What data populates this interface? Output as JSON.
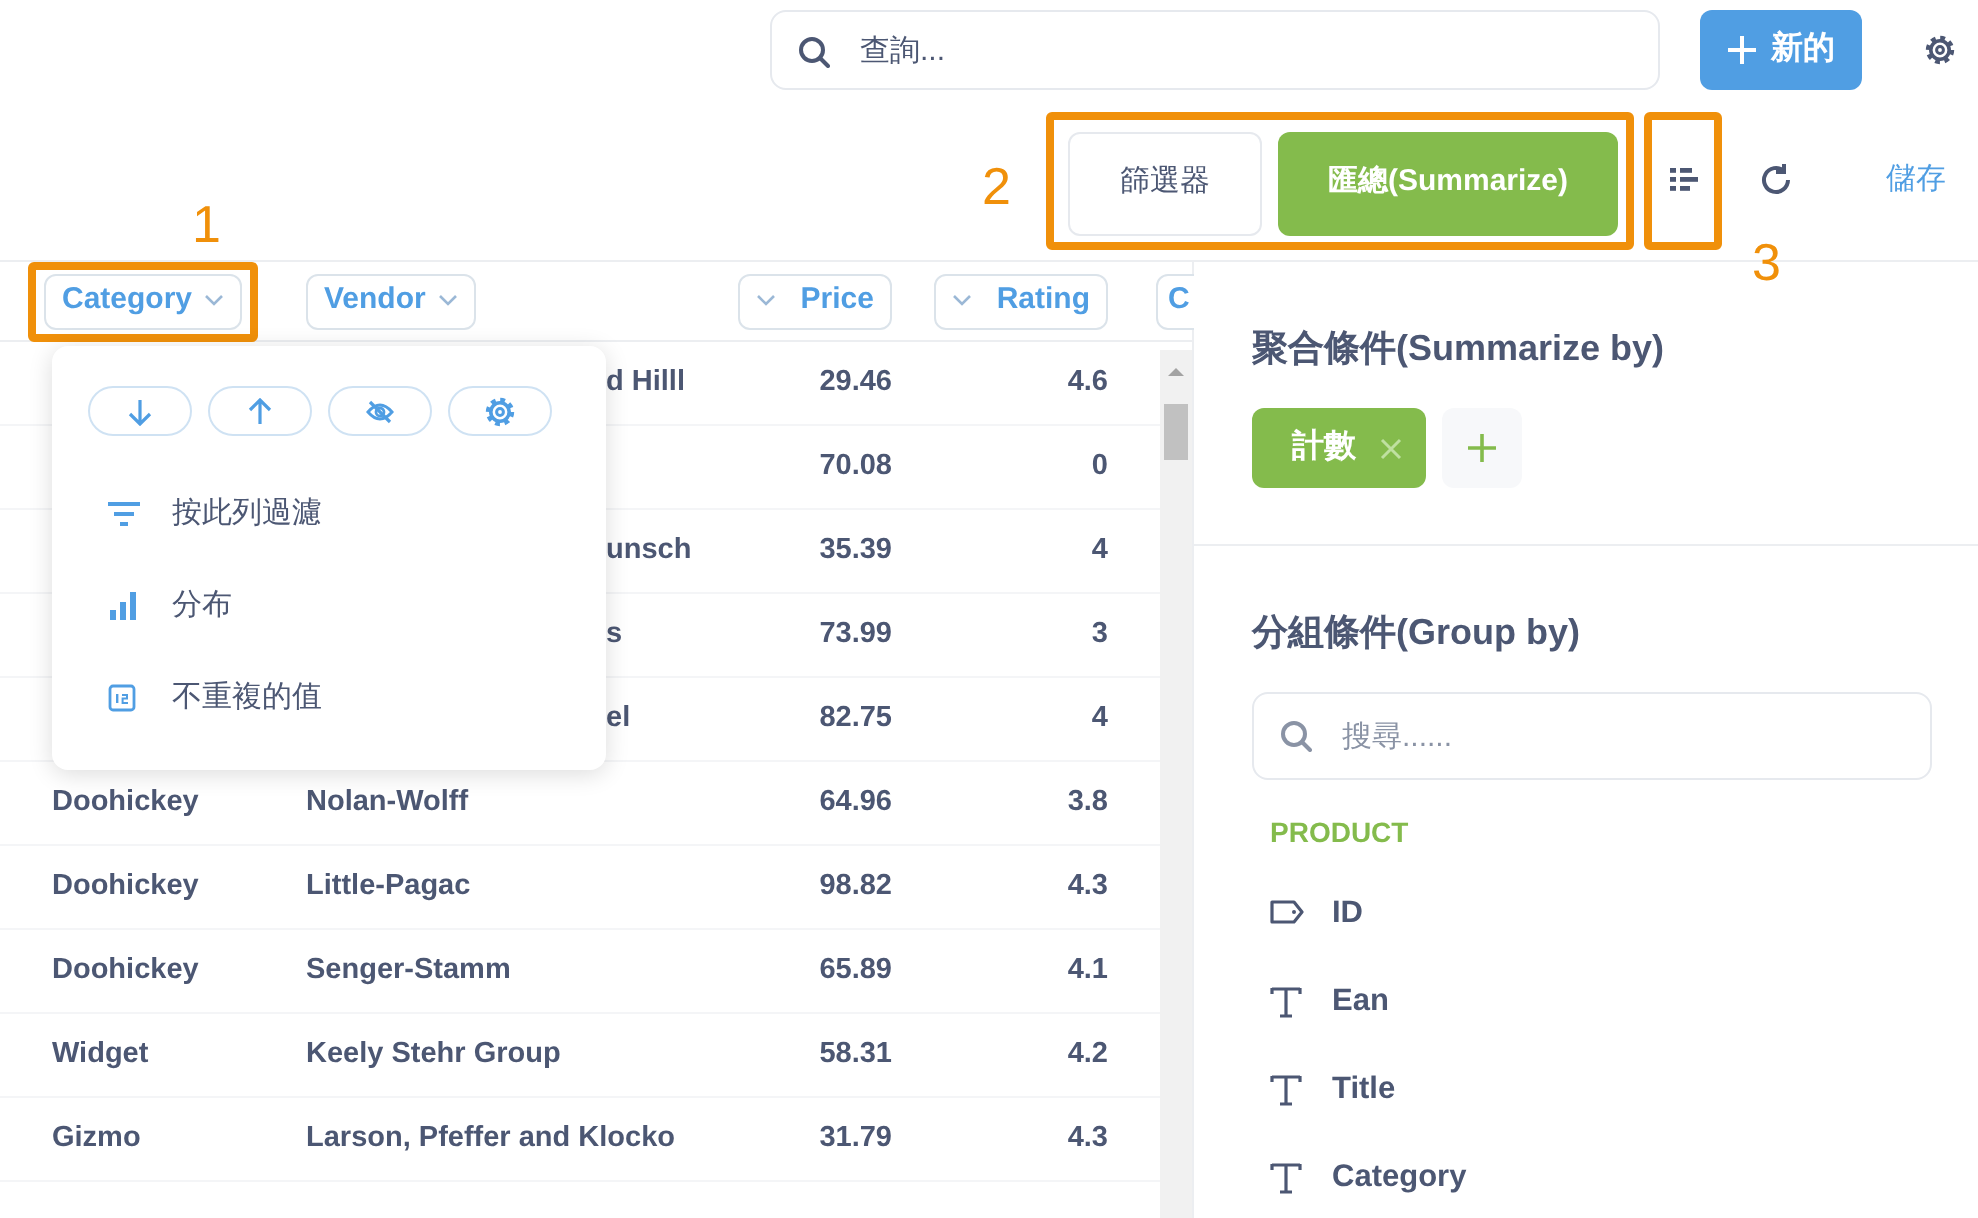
{
  "header": {
    "search": {
      "placeholder": "查詢..."
    },
    "new_button": "新的"
  },
  "toolbar": {
    "annotation": "2",
    "filter_button": "篩選器",
    "summarize_button": {
      "label": "匯總(Summarize)",
      "selected": true
    },
    "view_annotation": "3",
    "save_link": "儲存"
  },
  "table": {
    "columns": [
      {
        "label": "Category",
        "kind": "text",
        "annotation": "1"
      },
      {
        "label": "Vendor",
        "kind": "text"
      },
      {
        "label": "Price",
        "kind": "number"
      },
      {
        "label": "Rating",
        "kind": "number"
      },
      {
        "label": "C",
        "kind": "cut"
      }
    ],
    "rows": [
      {
        "vendor": "d Hilll",
        "vendor_clipped": true,
        "price": "29.46",
        "rating": "4.6"
      },
      {
        "price": "70.08",
        "rating": "0"
      },
      {
        "vendor": "unsch",
        "vendor_clipped": true,
        "price": "35.39",
        "rating": "4"
      },
      {
        "vendor": "s",
        "vendor_clipped": true,
        "price": "73.99",
        "rating": "3"
      },
      {
        "vendor": "el",
        "vendor_clipped": true,
        "price": "82.75",
        "rating": "4"
      },
      {
        "category": "Doohickey",
        "vendor": "Nolan-Wolff",
        "price": "64.96",
        "rating": "3.8"
      },
      {
        "category": "Doohickey",
        "vendor": "Little-Pagac",
        "price": "98.82",
        "rating": "4.3"
      },
      {
        "category": "Doohickey",
        "vendor": "Senger-Stamm",
        "price": "65.89",
        "rating": "4.1"
      },
      {
        "category": "Widget",
        "vendor": "Keely Stehr Group",
        "price": "58.31",
        "rating": "4.2"
      },
      {
        "category": "Gizmo",
        "vendor": "Larson, Pfeffer and Klocko",
        "price": "31.79",
        "rating": "4.3"
      }
    ]
  },
  "column_menu": {
    "items": [
      {
        "label": "按此列過濾",
        "kind": "filter"
      },
      {
        "label": "分布",
        "kind": "distribution"
      },
      {
        "label": "不重複的值",
        "kind": "distinct"
      }
    ]
  },
  "sidebar": {
    "summarize_title": "聚合條件(Summarize by)",
    "metrics": [
      {
        "label": "計數"
      }
    ],
    "group_title": "分組條件(Group by)",
    "search": {
      "placeholder": "搜尋......"
    },
    "section": "PRODUCT",
    "fields": [
      {
        "label": "ID",
        "kind": "key"
      },
      {
        "label": "Ean",
        "kind": "text"
      },
      {
        "label": "Title",
        "kind": "text"
      },
      {
        "label": "Category",
        "kind": "text"
      }
    ]
  }
}
